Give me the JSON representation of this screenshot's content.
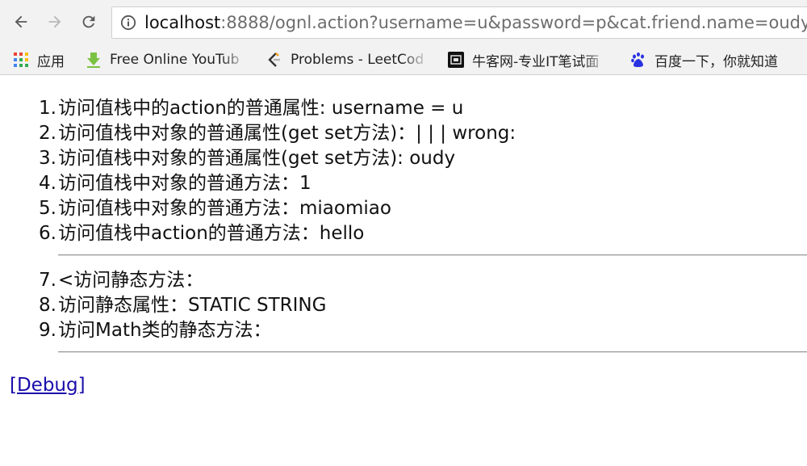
{
  "browser": {
    "url_host": "localhost",
    "url_rest": ":8888/ognl.action?username=u&password=p&cat.friend.name=oudy",
    "bookmarks": [
      {
        "label": "应用",
        "icon": "apps-grid-icon"
      },
      {
        "label": "Free Online YouTub",
        "icon": "download-arrow-icon"
      },
      {
        "label": "Problems - LeetCod",
        "icon": "leetcode-icon"
      },
      {
        "label": "牛客网-专业IT笔试面",
        "icon": "nowcoder-icon"
      },
      {
        "label": "百度一下，你就知道",
        "icon": "baidu-paw-icon"
      }
    ]
  },
  "page": {
    "items": [
      {
        "num": "1.",
        "text": "访问值栈中的action的普通属性: username = u"
      },
      {
        "num": "2.",
        "text": "访问值栈中对象的普通属性(get set方法)：| | | wrong:"
      },
      {
        "num": "3.",
        "text": "访问值栈中对象的普通属性(get set方法): oudy"
      },
      {
        "num": "4.",
        "text": "访问值栈中对象的普通方法：1"
      },
      {
        "num": "5.",
        "text": "访问值栈中对象的普通方法：miaomiao"
      },
      {
        "num": "6.",
        "text": "访问值栈中action的普通方法：hello"
      },
      {
        "num": "7.",
        "text": "<访问静态方法："
      },
      {
        "num": "8.",
        "text": "访问静态属性：STATIC STRING"
      },
      {
        "num": "9.",
        "text": "访问Math类的静态方法："
      }
    ],
    "debug_link": "[Debug]"
  }
}
